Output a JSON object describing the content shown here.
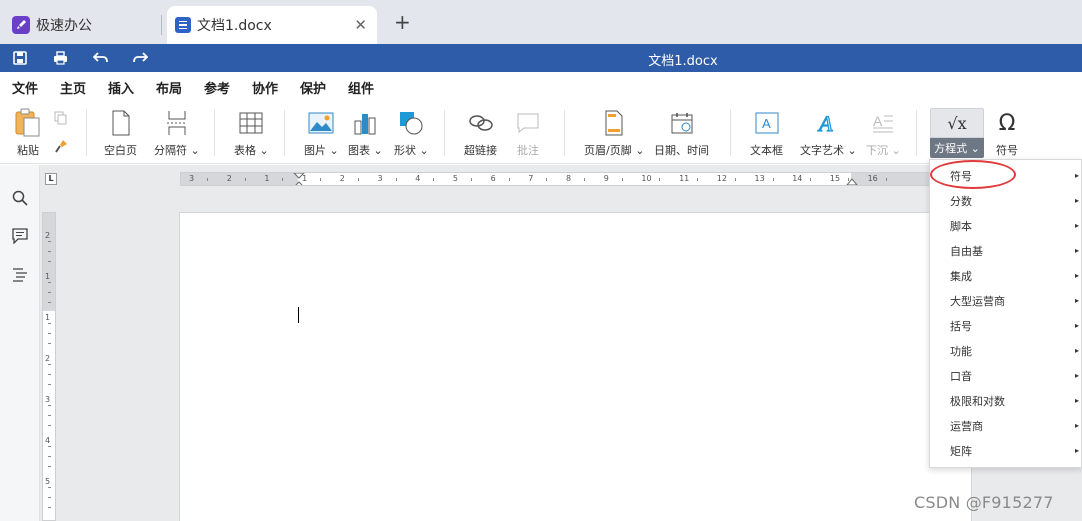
{
  "tabs": {
    "app_name": "极速办公",
    "doc_name": "文档1.docx",
    "close_symbol": "✕",
    "new_tab_symbol": "+"
  },
  "titlebar": {
    "title": "文档1.docx",
    "quick_access_icons": [
      "save-icon",
      "print-icon",
      "undo-icon",
      "redo-icon"
    ]
  },
  "menu": {
    "items": [
      "文件",
      "主页",
      "插入",
      "布局",
      "参考",
      "协作",
      "保护",
      "组件"
    ],
    "active": "插入"
  },
  "ribbon": {
    "paste": "粘贴",
    "blank_page": "空白页",
    "separator": "分隔符",
    "table": "表格",
    "picture": "图片",
    "chart": "图表",
    "shape": "形状",
    "hyperlink": "超链接",
    "comment": "批注",
    "header_footer": "页眉/页脚",
    "date_time": "日期、时间",
    "textbox": "文本框",
    "text_art": "文字艺术",
    "drop_cap": "下沉",
    "equation": "方程式",
    "symbol": "符号",
    "symbol_glyph": "Ω",
    "equation_glyph": "√x"
  },
  "rulers": {
    "corner": "L",
    "horizontal_labels": [
      "3",
      "2",
      "1",
      "1",
      "2",
      "3",
      "4",
      "5",
      "6",
      "7",
      "8",
      "9",
      "10",
      "11",
      "12",
      "13",
      "14",
      "15",
      "16"
    ],
    "vertical_labels": [
      "2",
      "1",
      "1",
      "2",
      "3",
      "4",
      "5"
    ]
  },
  "equation_menu": {
    "items": [
      "符号",
      "分数",
      "脚本",
      "自由基",
      "集成",
      "大型运营商",
      "括号",
      "功能",
      "口音",
      "极限和对数",
      "运营商",
      "矩阵"
    ],
    "highlighted": "符号",
    "arrow": "▸"
  },
  "watermark": "CSDN @F915277",
  "colors": {
    "title_bar": "#2f5ca8",
    "tab_bar": "#e3e6ec",
    "highlight_circle": "#e03a3a",
    "active_menu_underline": "#2f5ca8"
  }
}
